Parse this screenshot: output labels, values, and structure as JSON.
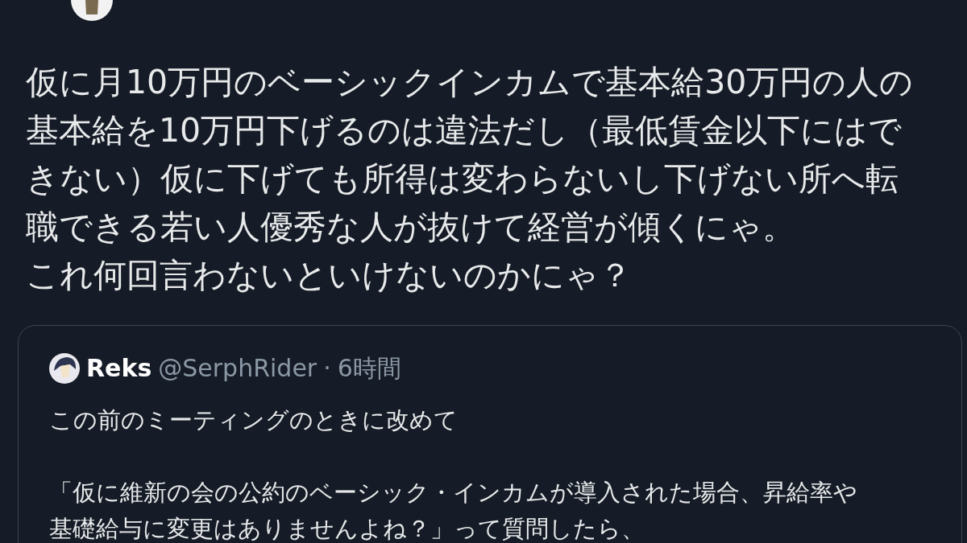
{
  "tweet": {
    "text_lines": [
      "仮に月10万円のベーシックインカムで基本給30万円の人の",
      "基本給を10万円下げるのは違法だし（最低賃金以下にはで",
      "きない）仮に下げても所得は変わらないし下げない所へ転",
      "職できる若い人優秀な人が抜けて経営が傾くにゃ。",
      "これ何回言わないといけないのかにゃ？"
    ]
  },
  "quoted_tweet": {
    "name": "Reks",
    "handle": "@SerphRider",
    "separator": "·",
    "time": "6時間",
    "paragraphs": [
      [
        "この前のミーティングのときに改めて"
      ],
      [
        "「仮に維新の会の公約のベーシック・インカムが導入された場合、昇給率や",
        "基礎給与に変更はありませんよね？」って質問したら、"
      ]
    ]
  }
}
